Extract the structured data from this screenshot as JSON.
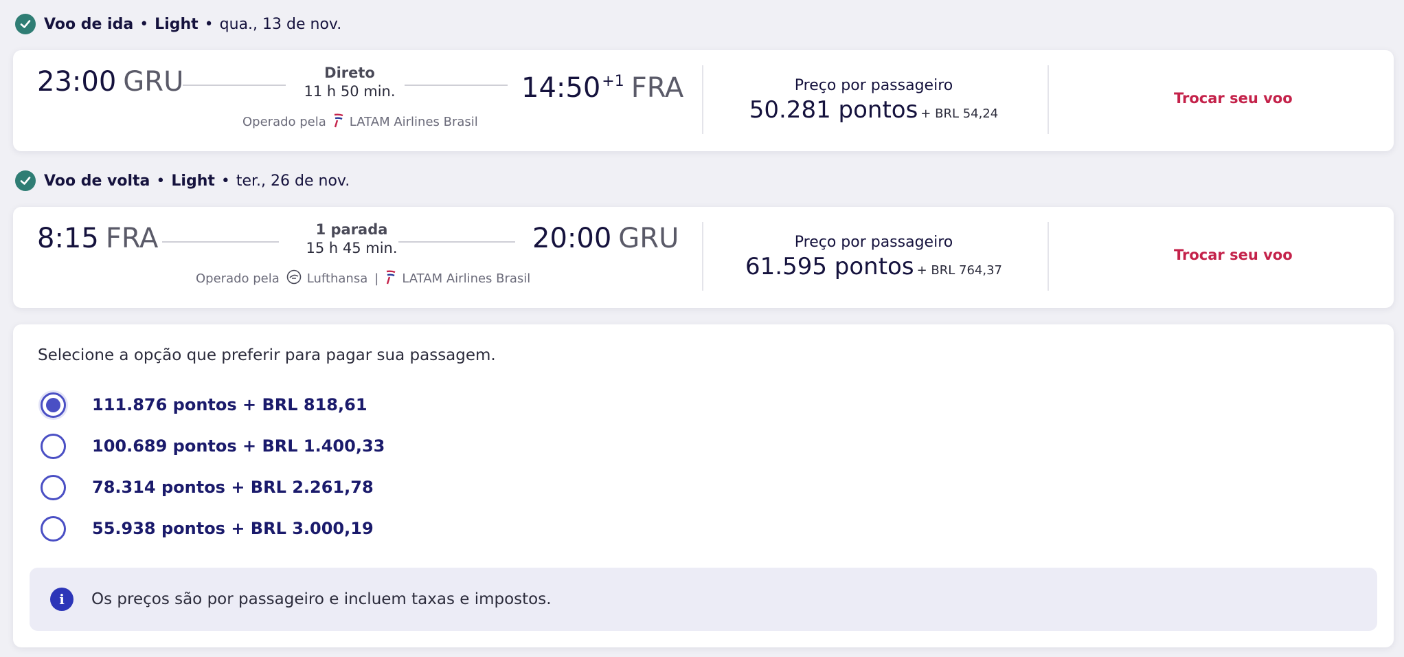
{
  "outbound": {
    "header": {
      "title": "Voo de ida",
      "fare": "Light",
      "date": "qua., 13 de nov."
    },
    "depart_time": "23:00",
    "depart_code": "GRU",
    "stops": "Direto",
    "duration": "11 h 50 min.",
    "arrive_time": "14:50",
    "arrive_day_offset": "+1",
    "arrive_code": "FRA",
    "operated_label": "Operado pela",
    "airlines": [
      "LATAM Airlines Brasil"
    ],
    "price_label": "Preço por passageiro",
    "price_points": "50.281 pontos",
    "price_brl": "+ BRL 54,24",
    "change_label": "Trocar seu voo"
  },
  "inbound": {
    "header": {
      "title": "Voo de volta",
      "fare": "Light",
      "date": "ter., 26 de nov."
    },
    "depart_time": "8:15",
    "depart_code": "FRA",
    "stops": "1 parada",
    "duration": "15 h 45 min.",
    "arrive_time": "20:00",
    "arrive_code": "GRU",
    "operated_label": "Operado pela",
    "airlines": [
      "Lufthansa",
      "LATAM Airlines Brasil"
    ],
    "airline_separator": "|",
    "price_label": "Preço por passageiro",
    "price_points": "61.595 pontos",
    "price_brl": "+ BRL 764,37",
    "change_label": "Trocar seu voo"
  },
  "payment": {
    "title": "Selecione a opção que preferir para pagar sua passagem.",
    "options": [
      {
        "label": "111.876 pontos + BRL 818,61",
        "selected": true
      },
      {
        "label": "100.689 pontos + BRL 1.400,33",
        "selected": false
      },
      {
        "label": "78.314 pontos + BRL 2.261,78",
        "selected": false
      },
      {
        "label": "55.938 pontos + BRL 3.000,19",
        "selected": false
      }
    ],
    "info_text": "Os preços são por passageiro e incluem taxas e impostos."
  },
  "separator_dot": "•",
  "colors": {
    "accent": "#4a4fc4",
    "link": "#c4224a",
    "check": "#2f7d74",
    "info": "#2c35b8"
  },
  "icons": {
    "check": "check-circle-icon",
    "info": "info-icon",
    "latam": "latam-logo-icon",
    "lufthansa": "lufthansa-logo-icon"
  }
}
